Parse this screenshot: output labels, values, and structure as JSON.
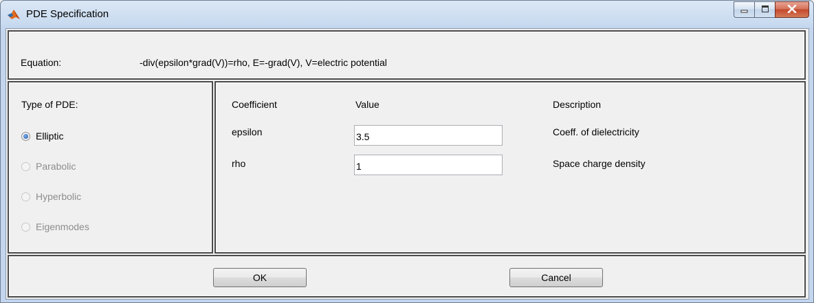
{
  "window": {
    "title": "PDE Specification",
    "icon": "matlab-logo-icon"
  },
  "equation": {
    "label": "Equation:",
    "text": "-div(epsilon*grad(V))=rho, E=-grad(V), V=electric potential"
  },
  "pde_type": {
    "title": "Type of PDE:",
    "options": [
      {
        "label": "Elliptic",
        "checked": true,
        "enabled": true
      },
      {
        "label": "Parabolic",
        "checked": false,
        "enabled": false
      },
      {
        "label": "Hyperbolic",
        "checked": false,
        "enabled": false
      },
      {
        "label": "Eigenmodes",
        "checked": false,
        "enabled": false
      }
    ]
  },
  "coefficients": {
    "headers": {
      "coefficient": "Coefficient",
      "value": "Value",
      "description": "Description"
    },
    "rows": [
      {
        "name": "epsilon",
        "value": "3.5",
        "description": "Coeff. of dielectricity"
      },
      {
        "name": "rho",
        "value": "1",
        "description": "Space charge density"
      }
    ]
  },
  "buttons": {
    "ok": "OK",
    "cancel": "Cancel"
  },
  "colors": {
    "titlebar": "#c9dbf0",
    "close_button": "#c4482c",
    "panel_border": "#4a4a4a",
    "background": "#f0f0f0"
  }
}
